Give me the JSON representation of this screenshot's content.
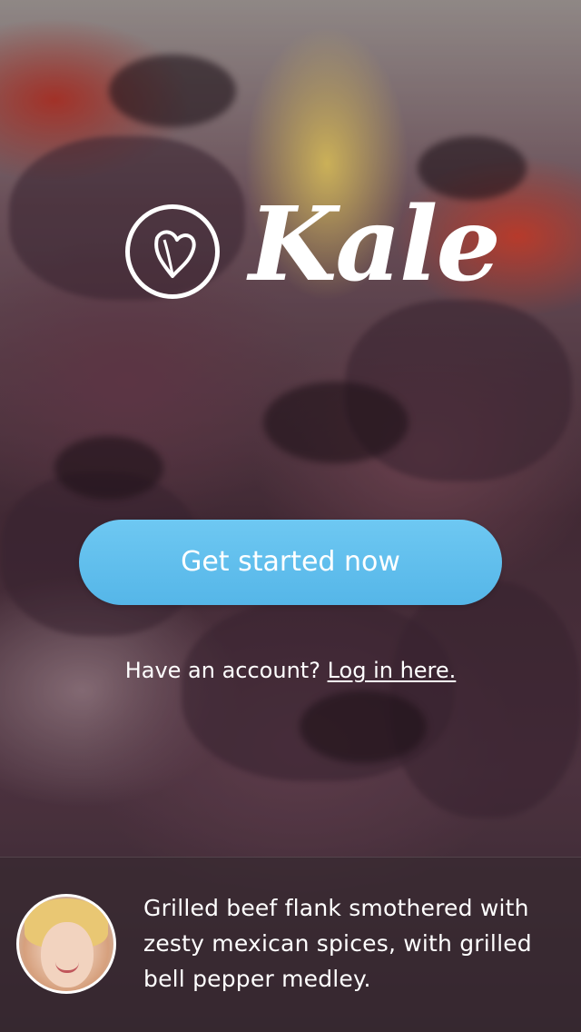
{
  "app": {
    "logo_text": "Kale",
    "logo_icon": "kale-leaf-icon"
  },
  "cta": {
    "label": "Get started now"
  },
  "login": {
    "prompt": "Have an account?",
    "link": "Log in here."
  },
  "featured": {
    "caption": "Grilled beef flank smothered with zesty mexican spices, with grilled bell pepper medley.",
    "avatar_icon": "user-avatar"
  },
  "colors": {
    "cta_background": "#5bbcec",
    "text": "#ffffff"
  }
}
